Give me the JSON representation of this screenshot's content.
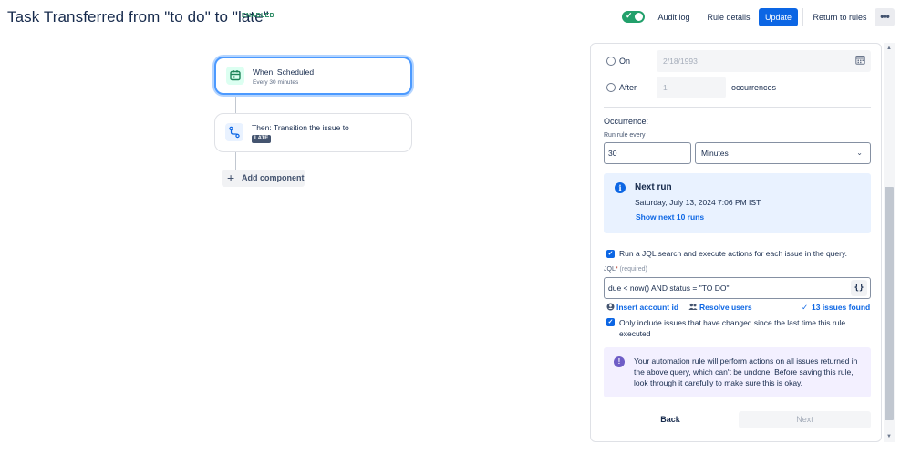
{
  "header": {
    "title": "Task Transferred from \"to do\" to \"late\"",
    "status_badge": "ENABLED",
    "toggle_on": true,
    "audit_log": "Audit log",
    "rule_details": "Rule details",
    "update": "Update",
    "return_to_rules": "Return to rules",
    "more_icon": "more-horizontal-icon",
    "more_glyph": "•••"
  },
  "flow": {
    "trigger": {
      "title": "When: Scheduled",
      "subtitle": "Every 30 minutes",
      "icon": "calendar-icon"
    },
    "action": {
      "title": "Then: Transition the issue to",
      "badge": "LATE",
      "icon": "transition-icon"
    },
    "add_component": "Add component"
  },
  "panel": {
    "end_on": {
      "label": "On",
      "value": "2/18/1993",
      "icon": "calendar-icon"
    },
    "end_after": {
      "label": "After",
      "value": "1",
      "suffix": "occurrences"
    },
    "occurrence_heading": "Occurrence:",
    "run_rule_every_label": "Run rule every",
    "interval_value": "30",
    "interval_unit": "Minutes",
    "next_run": {
      "title": "Next run",
      "date": "Saturday, July 13, 2024 7:06 PM IST",
      "show_more": "Show next 10 runs"
    },
    "run_jql": {
      "checked": true,
      "label": "Run a JQL search and execute actions for each issue in the query."
    },
    "jql": {
      "label": "JQL",
      "required_mark": "*",
      "hint": "(required)",
      "value": "due < now() AND status = \"TO DO\"",
      "button": "{}"
    },
    "insert_account_id": "Insert account id",
    "resolve_users": "Resolve users",
    "issues_found": "13 issues found",
    "only_changed": {
      "checked": true,
      "label": "Only include issues that have changed since the last time this rule executed"
    },
    "warning": "Your automation rule will perform actions on all issues returned in the above query, which can't be undone. Before saving this rule, look through it carefully to make sure this is okay.",
    "back": "Back",
    "next": "Next"
  },
  "colors": {
    "primary": "#0c66e4",
    "success": "#22a06b",
    "info_bg": "#e9f2ff",
    "discovery_bg": "#f3f0ff"
  }
}
